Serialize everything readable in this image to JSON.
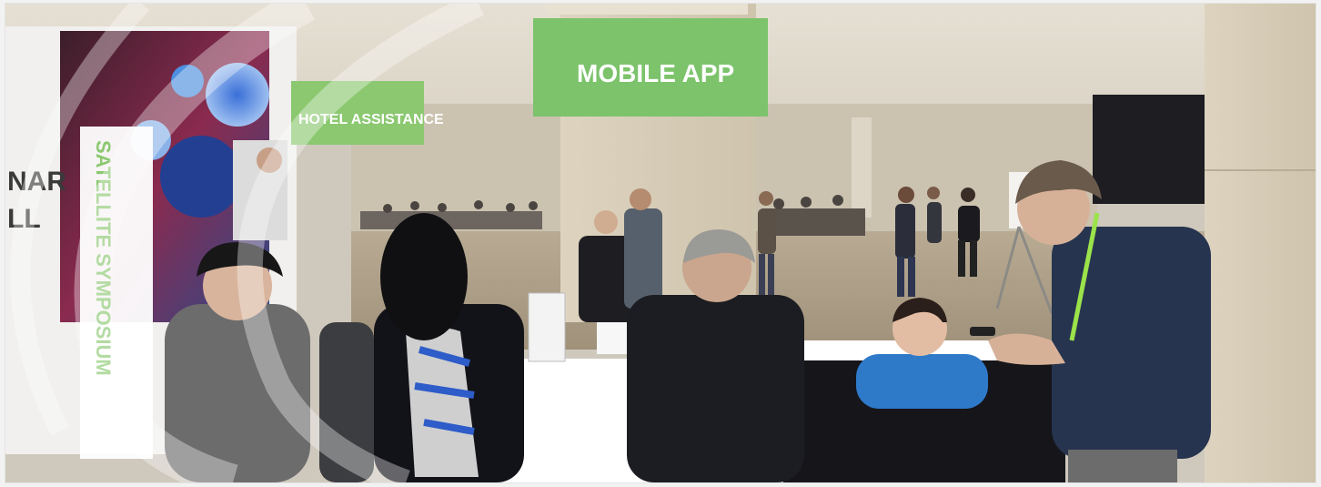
{
  "signs": {
    "mobile_app": "MOBILE APP",
    "hotel_assistance": "HOTEL ASSISTANCE"
  },
  "banner": {
    "partial_line_1": "NAR",
    "partial_line_2": "LL",
    "vertical_text": "SATELLITE SYMPOSIUM"
  },
  "colors": {
    "sign_green": "#7cc36b",
    "banner_green": "#8bc870"
  }
}
